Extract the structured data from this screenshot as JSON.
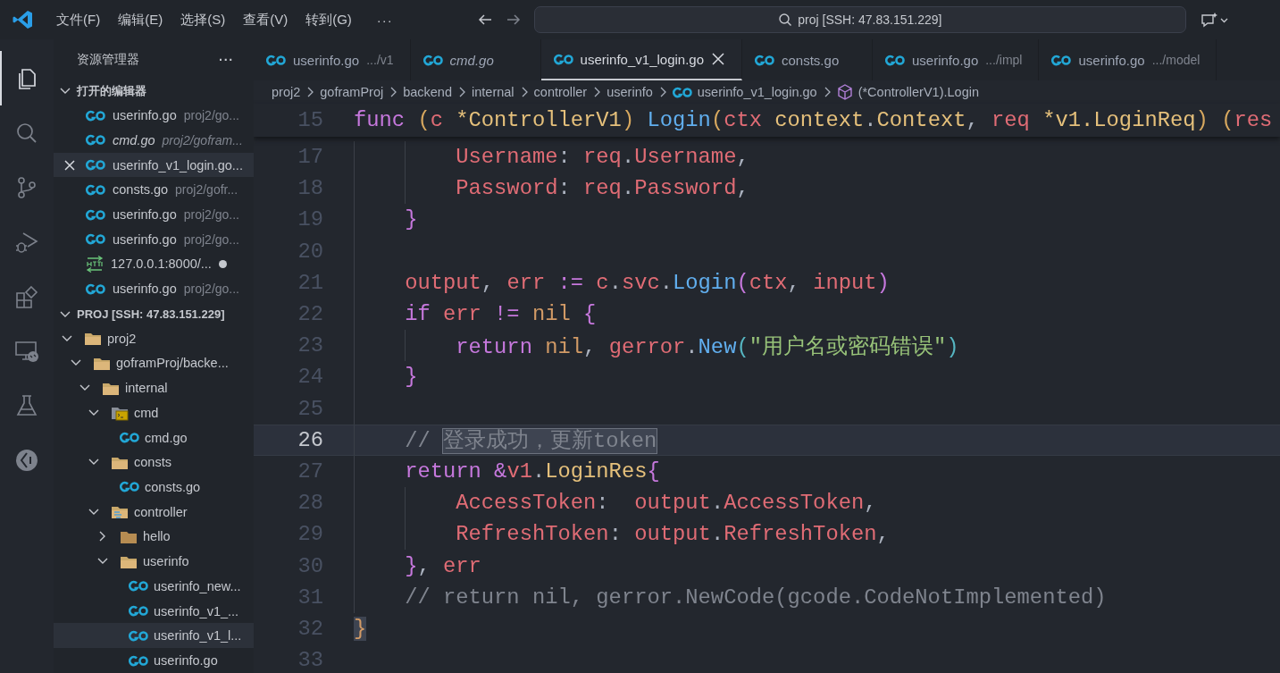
{
  "titlebar": {
    "menus": [
      "文件(F)",
      "编辑(E)",
      "选择(S)",
      "查看(V)",
      "转到(G)"
    ],
    "more": "···",
    "search": "proj [SSH: 47.83.151.229]"
  },
  "activity_bar": [
    {
      "kind": "explorer",
      "selected": true
    },
    {
      "kind": "search",
      "selected": false
    },
    {
      "kind": "source-control",
      "selected": false
    },
    {
      "kind": "run-debug",
      "selected": false
    },
    {
      "kind": "extensions",
      "selected": false
    },
    {
      "kind": "remote",
      "selected": false
    },
    {
      "kind": "testing",
      "selected": false
    },
    {
      "kind": "gauge",
      "selected": false
    }
  ],
  "sidebar": {
    "title": "资源管理器",
    "more": "···",
    "open_editors": {
      "label": "打开的编辑器",
      "expanded": true,
      "items": [
        {
          "name": "userinfo.go",
          "path": "proj2/go...",
          "kind": "go",
          "italic": false,
          "selected": false,
          "dirty": false
        },
        {
          "name": "cmd.go",
          "path": "proj2/gofram...",
          "kind": "go",
          "italic": true,
          "selected": false,
          "dirty": false
        },
        {
          "name": "userinfo_v1_login.go...",
          "kind": "go",
          "italic": false,
          "selected": true,
          "dirty": false
        },
        {
          "name": "consts.go",
          "path": "proj2/gofr...",
          "kind": "go",
          "italic": false,
          "selected": false,
          "dirty": false
        },
        {
          "name": "userinfo.go",
          "path": "proj2/go...",
          "kind": "go",
          "italic": false,
          "selected": false,
          "dirty": false
        },
        {
          "name": "userinfo.go",
          "path": "proj2/go...",
          "kind": "go",
          "italic": false,
          "selected": false,
          "dirty": false
        },
        {
          "name": "127.0.0.1:8000/...",
          "kind": "http",
          "italic": false,
          "selected": false,
          "dirty": true
        },
        {
          "name": "userinfo.go",
          "path": "proj2/go...",
          "kind": "go",
          "italic": false,
          "selected": false,
          "dirty": false
        }
      ]
    },
    "folder": {
      "label": "PROJ [SSH: 47.83.151.229]",
      "expanded": true,
      "tree": [
        {
          "name": "proj2",
          "kind": "folder",
          "expanded": true,
          "selected": false,
          "children": [
            {
              "name": "goframProj/backe...",
              "kind": "folder",
              "expanded": true,
              "selected": false,
              "children": [
                {
                  "name": "internal",
                  "kind": "folder",
                  "expanded": true,
                  "selected": false,
                  "children": [
                    {
                      "name": "cmd",
                      "kind": "cmd-folder",
                      "expanded": true,
                      "selected": false,
                      "children": [
                        {
                          "name": "cmd.go",
                          "kind": "go",
                          "selected": false
                        }
                      ]
                    },
                    {
                      "name": "consts",
                      "kind": "folder",
                      "expanded": true,
                      "selected": false,
                      "children": [
                        {
                          "name": "consts.go",
                          "kind": "go",
                          "selected": false
                        }
                      ]
                    },
                    {
                      "name": "controller",
                      "kind": "controller-folder",
                      "expanded": true,
                      "selected": false,
                      "children": [
                        {
                          "name": "hello",
                          "kind": "folder",
                          "expanded": false,
                          "selected": false
                        },
                        {
                          "name": "userinfo",
                          "kind": "folder",
                          "expanded": true,
                          "selected": false,
                          "children": [
                            {
                              "name": "userinfo_new...",
                              "kind": "go",
                              "selected": false
                            },
                            {
                              "name": "userinfo_v1_...",
                              "kind": "go",
                              "selected": false
                            },
                            {
                              "name": "userinfo_v1_l...",
                              "kind": "go",
                              "selected": true
                            },
                            {
                              "name": "userinfo.go",
                              "kind": "go",
                              "selected": false
                            }
                          ]
                        }
                      ]
                    }
                  ]
                }
              ]
            }
          ]
        }
      ]
    }
  },
  "tabs": [
    {
      "name": "userinfo.go",
      "detail": ".../v1",
      "italic": false,
      "selected": false
    },
    {
      "name": "cmd.go",
      "italic": true,
      "selected": false
    },
    {
      "name": "userinfo_v1_login.go",
      "italic": false,
      "selected": true
    },
    {
      "name": "consts.go",
      "italic": false,
      "selected": false
    },
    {
      "name": "userinfo.go",
      "detail": ".../impl",
      "italic": false,
      "selected": false
    },
    {
      "name": "userinfo.go",
      "detail": ".../model",
      "italic": false,
      "selected": false
    }
  ],
  "breadcrumb": [
    {
      "text": "proj2",
      "kind": "folder"
    },
    {
      "text": "goframProj",
      "kind": "folder"
    },
    {
      "text": "backend",
      "kind": "folder"
    },
    {
      "text": "internal",
      "kind": "folder"
    },
    {
      "text": "controller",
      "kind": "folder"
    },
    {
      "text": "userinfo",
      "kind": "folder"
    },
    {
      "text": "userinfo_v1_login.go",
      "kind": "go"
    },
    {
      "text": "(*ControllerV1).Login",
      "kind": "symbol"
    }
  ],
  "editor": {
    "sticky": {
      "number": "15",
      "tokens": [
        {
          "text": "func",
          "kind": "keyword"
        },
        {
          "text": " (",
          "kind": "bracket1"
        },
        {
          "text": "c",
          "kind": "variable"
        },
        {
          "text": " *ControllerV1",
          "kind": "type"
        },
        {
          "text": ")",
          "kind": "bracket1"
        },
        {
          "text": " Login",
          "kind": "function"
        },
        {
          "text": "(",
          "kind": "bracket1"
        },
        {
          "text": "ctx",
          "kind": "variable"
        },
        {
          "text": " context",
          "kind": "type"
        },
        {
          "text": ".",
          "kind": "plain"
        },
        {
          "text": "Context",
          "kind": "type"
        },
        {
          "text": ", ",
          "kind": "plain"
        },
        {
          "text": "req",
          "kind": "variable"
        },
        {
          "text": " *v1.LoginReq",
          "kind": "type"
        },
        {
          "text": ")",
          "kind": "bracket1"
        },
        {
          "text": " (",
          "kind": "bracket1"
        },
        {
          "text": "res",
          "kind": "variable"
        }
      ]
    },
    "lines": [
      {
        "number": "17",
        "current": false,
        "tokens": [
          {
            "text": "        Username",
            "kind": "variable"
          },
          {
            "text": ":",
            "kind": "plain"
          },
          {
            "text": " req",
            "kind": "variable"
          },
          {
            "text": ".",
            "kind": "plain"
          },
          {
            "text": "Username",
            "kind": "variable"
          },
          {
            "text": ",",
            "kind": "plain"
          }
        ]
      },
      {
        "number": "18",
        "current": false,
        "tokens": [
          {
            "text": "        Password",
            "kind": "variable"
          },
          {
            "text": ":",
            "kind": "plain"
          },
          {
            "text": " req",
            "kind": "variable"
          },
          {
            "text": ".",
            "kind": "plain"
          },
          {
            "text": "Password",
            "kind": "variable"
          },
          {
            "text": ",",
            "kind": "plain"
          }
        ]
      },
      {
        "number": "19",
        "current": false,
        "tokens": [
          {
            "text": "    }",
            "kind": "bracket2"
          }
        ]
      },
      {
        "number": "20",
        "current": false
      },
      {
        "number": "21",
        "current": false,
        "tokens": [
          {
            "text": "    output",
            "kind": "variable"
          },
          {
            "text": ",",
            "kind": "plain"
          },
          {
            "text": " err",
            "kind": "variable"
          },
          {
            "text": " :=",
            "kind": "operator"
          },
          {
            "text": " c",
            "kind": "variable"
          },
          {
            "text": ".",
            "kind": "plain"
          },
          {
            "text": "svc",
            "kind": "variable"
          },
          {
            "text": ".",
            "kind": "plain"
          },
          {
            "text": "Login",
            "kind": "function"
          },
          {
            "text": "(",
            "kind": "bracket2"
          },
          {
            "text": "ctx",
            "kind": "variable"
          },
          {
            "text": ",",
            "kind": "plain"
          },
          {
            "text": " input",
            "kind": "variable"
          },
          {
            "text": ")",
            "kind": "bracket2"
          }
        ]
      },
      {
        "number": "22",
        "current": false,
        "tokens": [
          {
            "text": "    if",
            "kind": "keyword"
          },
          {
            "text": " err",
            "kind": "variable"
          },
          {
            "text": " !=",
            "kind": "operator"
          },
          {
            "text": " nil",
            "kind": "constant"
          },
          {
            "text": " {",
            "kind": "bracket2"
          }
        ]
      },
      {
        "number": "23",
        "current": false,
        "tokens": [
          {
            "text": "        return",
            "kind": "keyword"
          },
          {
            "text": " nil",
            "kind": "constant"
          },
          {
            "text": ",",
            "kind": "plain"
          },
          {
            "text": " gerror",
            "kind": "variable"
          },
          {
            "text": ".",
            "kind": "plain"
          },
          {
            "text": "New",
            "kind": "function"
          },
          {
            "text": "(",
            "kind": "bracket3"
          },
          {
            "text": "\"用户名或密码错误\"",
            "kind": "string"
          },
          {
            "text": ")",
            "kind": "bracket3"
          }
        ]
      },
      {
        "number": "24",
        "current": false,
        "tokens": [
          {
            "text": "    }",
            "kind": "bracket2"
          }
        ]
      },
      {
        "number": "25",
        "current": false
      },
      {
        "number": "26",
        "current": true,
        "tokens": [
          {
            "text": "    //",
            "kind": "comment"
          },
          {
            "text": " 登录成功，更新token",
            "kind": "selection"
          }
        ]
      },
      {
        "number": "27",
        "current": false,
        "tokens": [
          {
            "text": "    return",
            "kind": "keyword"
          },
          {
            "text": " &",
            "kind": "operator"
          },
          {
            "text": "v1",
            "kind": "variable"
          },
          {
            "text": ".",
            "kind": "plain"
          },
          {
            "text": "LoginRes",
            "kind": "type"
          },
          {
            "text": "{",
            "kind": "bracket2"
          }
        ]
      },
      {
        "number": "28",
        "current": false,
        "tokens": [
          {
            "text": "        AccessToken",
            "kind": "variable"
          },
          {
            "text": ":",
            "kind": "plain"
          },
          {
            "text": "  output",
            "kind": "variable"
          },
          {
            "text": ".",
            "kind": "plain"
          },
          {
            "text": "AccessToken",
            "kind": "variable"
          },
          {
            "text": ",",
            "kind": "plain"
          }
        ]
      },
      {
        "number": "29",
        "current": false,
        "tokens": [
          {
            "text": "        RefreshToken",
            "kind": "variable"
          },
          {
            "text": ":",
            "kind": "plain"
          },
          {
            "text": " output",
            "kind": "variable"
          },
          {
            "text": ".",
            "kind": "plain"
          },
          {
            "text": "RefreshToken",
            "kind": "variable"
          },
          {
            "text": ",",
            "kind": "plain"
          }
        ]
      },
      {
        "number": "30",
        "current": false,
        "tokens": [
          {
            "text": "    }",
            "kind": "bracket2"
          },
          {
            "text": ",",
            "kind": "plain"
          },
          {
            "text": " err",
            "kind": "variable"
          }
        ]
      },
      {
        "number": "31",
        "current": false,
        "tokens": [
          {
            "text": "    // return nil, gerror.NewCode(gcode.CodeNotImplemented)",
            "kind": "comment"
          }
        ]
      },
      {
        "number": "32",
        "current": false,
        "tokens": [
          {
            "text": "}",
            "kind": "bracket_match"
          }
        ]
      },
      {
        "number": "33",
        "current": false
      }
    ]
  }
}
